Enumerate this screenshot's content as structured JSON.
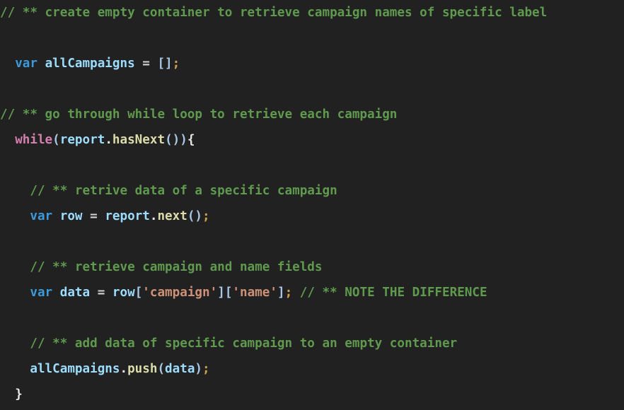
{
  "editor": {
    "background_color": "#212121",
    "language": "javascript",
    "font_size_px": 17.6,
    "line_height_px": 36,
    "colors": {
      "comment": "#5f9a4e",
      "keyword": "#3d9ad8",
      "control_keyword": "#d47fae",
      "variable": "#9cdcfe",
      "function": "#dcdcaa",
      "string": "#ce9178",
      "punctuation": "#e8e8e8",
      "bracket": "#a8c8e8",
      "semicolon": "#d0a050",
      "operator": "#d4d4d4"
    },
    "lines": [
      {
        "index": 1,
        "wraps": true,
        "text": "// ** create empty container to retrieve campaign names of specific label",
        "tokens": [
          {
            "t": "// ** create empty container to retrieve campaign names of specific label",
            "c": "c-comment"
          }
        ]
      },
      {
        "index": 2,
        "wraps": false,
        "text": "  var allCampaigns = [];",
        "tokens": [
          {
            "t": "  ",
            "c": "c-op"
          },
          {
            "t": "var",
            "c": "c-keyword"
          },
          {
            "t": " ",
            "c": "c-op"
          },
          {
            "t": "allCampaigns",
            "c": "c-var"
          },
          {
            "t": " ",
            "c": "c-op"
          },
          {
            "t": "=",
            "c": "c-op"
          },
          {
            "t": " ",
            "c": "c-op"
          },
          {
            "t": "[]",
            "c": "c-bracket"
          },
          {
            "t": ";",
            "c": "c-semi"
          }
        ]
      },
      {
        "index": 3,
        "wraps": false,
        "text": "",
        "tokens": []
      },
      {
        "index": 4,
        "wraps": false,
        "text": "// ** go through while loop to retrieve each campaign",
        "tokens": [
          {
            "t": "// ** go through while loop to retrieve each campaign",
            "c": "c-comment"
          }
        ]
      },
      {
        "index": 5,
        "wraps": false,
        "text": "  while(report.hasNext()){",
        "tokens": [
          {
            "t": "  ",
            "c": "c-op"
          },
          {
            "t": "while",
            "c": "c-control"
          },
          {
            "t": "(",
            "c": "c-bracket"
          },
          {
            "t": "report",
            "c": "c-var"
          },
          {
            "t": ".",
            "c": "c-punct"
          },
          {
            "t": "hasNext",
            "c": "c-func"
          },
          {
            "t": "()",
            "c": "c-bracket"
          },
          {
            "t": ")",
            "c": "c-bracket"
          },
          {
            "t": "{",
            "c": "c-brace"
          }
        ]
      },
      {
        "index": 6,
        "wraps": false,
        "text": "",
        "tokens": []
      },
      {
        "index": 7,
        "wraps": false,
        "text": "    // ** retrive data of a specific campaign",
        "tokens": [
          {
            "t": "    ",
            "c": "c-op"
          },
          {
            "t": "// ** retrive data of a specific campaign",
            "c": "c-comment"
          }
        ]
      },
      {
        "index": 8,
        "wraps": false,
        "text": "    var row = report.next();",
        "tokens": [
          {
            "t": "    ",
            "c": "c-op"
          },
          {
            "t": "var",
            "c": "c-keyword"
          },
          {
            "t": " ",
            "c": "c-op"
          },
          {
            "t": "row",
            "c": "c-var"
          },
          {
            "t": " ",
            "c": "c-op"
          },
          {
            "t": "=",
            "c": "c-op"
          },
          {
            "t": " ",
            "c": "c-op"
          },
          {
            "t": "report",
            "c": "c-var"
          },
          {
            "t": ".",
            "c": "c-punct"
          },
          {
            "t": "next",
            "c": "c-func"
          },
          {
            "t": "()",
            "c": "c-bracket"
          },
          {
            "t": ";",
            "c": "c-semi"
          }
        ]
      },
      {
        "index": 9,
        "wraps": false,
        "text": "",
        "tokens": []
      },
      {
        "index": 10,
        "wraps": false,
        "text": "    // ** retrieve campaign and name fields",
        "tokens": [
          {
            "t": "    ",
            "c": "c-op"
          },
          {
            "t": "// ** retrieve campaign and name fields",
            "c": "c-comment"
          }
        ]
      },
      {
        "index": 11,
        "wraps": false,
        "text": "    var data = row['campaign']['name']; // ** NOTE THE DIFFERENCE",
        "tokens": [
          {
            "t": "    ",
            "c": "c-op"
          },
          {
            "t": "var",
            "c": "c-keyword"
          },
          {
            "t": " ",
            "c": "c-op"
          },
          {
            "t": "data",
            "c": "c-var"
          },
          {
            "t": " ",
            "c": "c-op"
          },
          {
            "t": "=",
            "c": "c-op"
          },
          {
            "t": " ",
            "c": "c-op"
          },
          {
            "t": "row",
            "c": "c-var"
          },
          {
            "t": "[",
            "c": "c-bracket"
          },
          {
            "t": "'campaign'",
            "c": "c-string"
          },
          {
            "t": "]",
            "c": "c-bracket"
          },
          {
            "t": "[",
            "c": "c-bracket"
          },
          {
            "t": "'name'",
            "c": "c-string"
          },
          {
            "t": "]",
            "c": "c-bracket"
          },
          {
            "t": ";",
            "c": "c-semi"
          },
          {
            "t": " ",
            "c": "c-op"
          },
          {
            "t": "// ** NOTE THE DIFFERENCE",
            "c": "c-comment"
          }
        ]
      },
      {
        "index": 12,
        "wraps": false,
        "text": "",
        "tokens": []
      },
      {
        "index": 13,
        "wraps": false,
        "text": "    // ** add data of specific campaign to an empty container",
        "tokens": [
          {
            "t": "    ",
            "c": "c-op"
          },
          {
            "t": "// ** add data of specific campaign to an empty container",
            "c": "c-comment"
          }
        ]
      },
      {
        "index": 14,
        "wraps": false,
        "text": "    allCampaigns.push(data);",
        "tokens": [
          {
            "t": "    ",
            "c": "c-op"
          },
          {
            "t": "allCampaigns",
            "c": "c-var"
          },
          {
            "t": ".",
            "c": "c-punct"
          },
          {
            "t": "push",
            "c": "c-func"
          },
          {
            "t": "(",
            "c": "c-bracket"
          },
          {
            "t": "data",
            "c": "c-var"
          },
          {
            "t": ")",
            "c": "c-bracket"
          },
          {
            "t": ";",
            "c": "c-semi"
          }
        ]
      },
      {
        "index": 15,
        "wraps": false,
        "text": "  }",
        "tokens": [
          {
            "t": "  ",
            "c": "c-op"
          },
          {
            "t": "}",
            "c": "c-brace"
          }
        ]
      }
    ]
  }
}
